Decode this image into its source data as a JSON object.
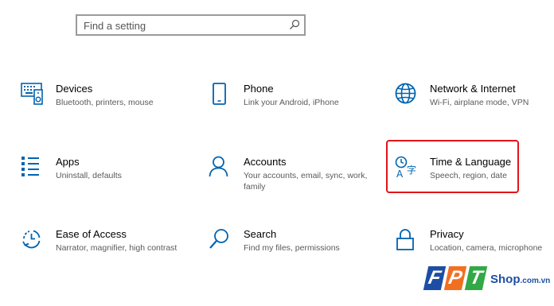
{
  "search": {
    "placeholder": "Find a setting"
  },
  "tiles": [
    {
      "title": "Devices",
      "desc": "Bluetooth, printers, mouse",
      "icon": "devices-icon"
    },
    {
      "title": "Phone",
      "desc": "Link your Android, iPhone",
      "icon": "phone-icon"
    },
    {
      "title": "Network & Internet",
      "desc": "Wi-Fi, airplane mode, VPN",
      "icon": "globe-icon"
    },
    {
      "title": "Apps",
      "desc": "Uninstall, defaults",
      "icon": "apps-list-icon"
    },
    {
      "title": "Accounts",
      "desc": "Your accounts, email, sync, work, family",
      "icon": "person-icon"
    },
    {
      "title": "Time & Language",
      "desc": "Speech, region, date",
      "icon": "time-language-icon"
    },
    {
      "title": "Ease of Access",
      "desc": "Narrator, magnifier, high contrast",
      "icon": "ease-of-access-icon"
    },
    {
      "title": "Search",
      "desc": "Find my files, permissions",
      "icon": "magnifier-icon"
    },
    {
      "title": "Privacy",
      "desc": "Location, camera, microphone",
      "icon": "lock-icon"
    }
  ],
  "watermark": {
    "letters": [
      "F",
      "P",
      "T"
    ],
    "shop": "Shop",
    "domain": ".com.vn"
  },
  "colors": {
    "accent": "#0063b1",
    "highlight": "#e2141a",
    "brand_orange": "#f26f21",
    "brand_blue": "#1d4ea4",
    "brand_green": "#32a846"
  }
}
